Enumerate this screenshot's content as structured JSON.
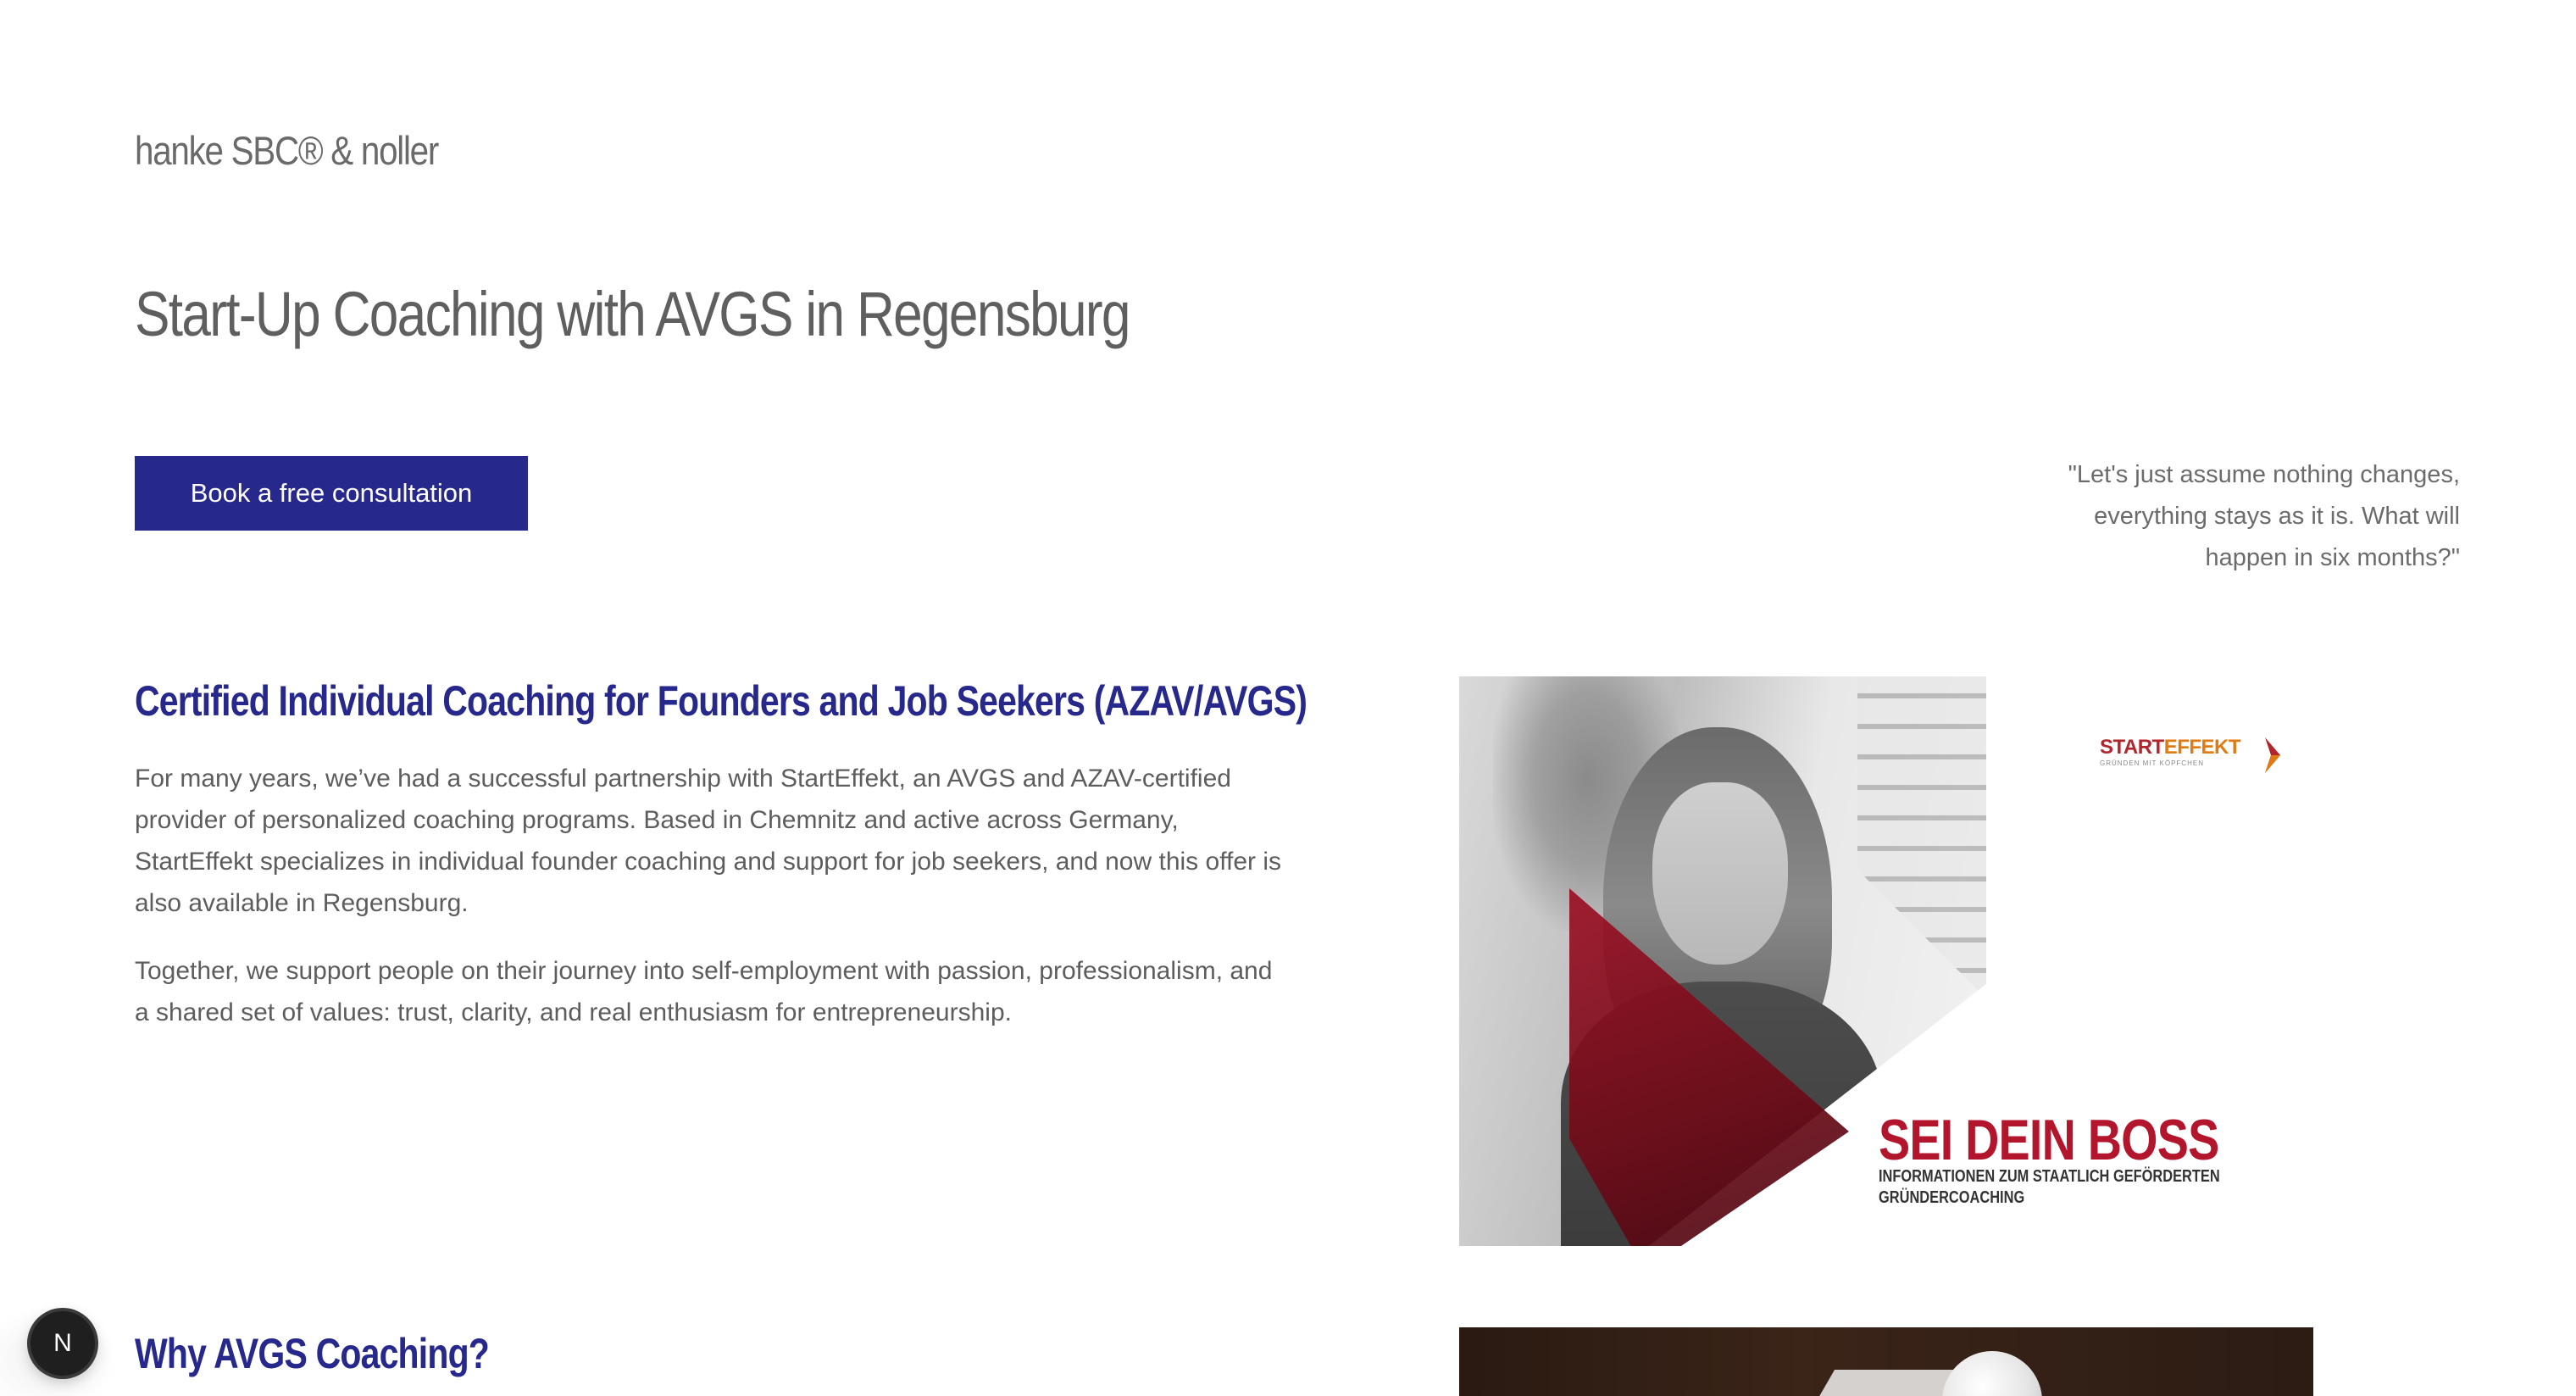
{
  "header": {
    "brand": "hanke SBC® & noller"
  },
  "hero": {
    "title": "Start-Up Coaching with AVGS in Regensburg",
    "cta_label": "Book a free consultation",
    "quote": "\"Let's just assume nothing changes, everything stays as it is. What will happen in six months?\""
  },
  "section_certified": {
    "heading": "Certified Individual Coaching for Founders and Job Seekers (AZAV/AVGS)",
    "paragraph_1": "For many years, we’ve had a successful partnership with StartEffekt, an AVGS and AZAV-certified provider of personalized coaching programs. Based in Chemnitz and active across Germany, StartEffekt specializes in individual founder coaching and support for job seekers, and now this offer is also available in Regensburg.",
    "paragraph_2": "Together, we support people on their journey into self-employment with passion, professionalism, and a shared set of values: trust, clarity, and real enthusiasm for entrepreneurship."
  },
  "promo_image": {
    "logo_start": "START",
    "logo_effekt": "EFFEKT",
    "logo_tagline": "GRÜNDEN MIT KÖPFCHEN",
    "headline": "SEI DEIN BOSS",
    "subline": "INFORMATIONEN ZUM STAATLICH GEFÖRDERTEN GRÜNDERCOACHING",
    "accent_color": "#b3162c"
  },
  "section_why": {
    "heading": "Why AVGS Coaching?"
  },
  "floating_badge": {
    "label": "N"
  },
  "colors": {
    "primary": "#27288c",
    "text": "#5d5d5d",
    "background": "#ffffff"
  }
}
